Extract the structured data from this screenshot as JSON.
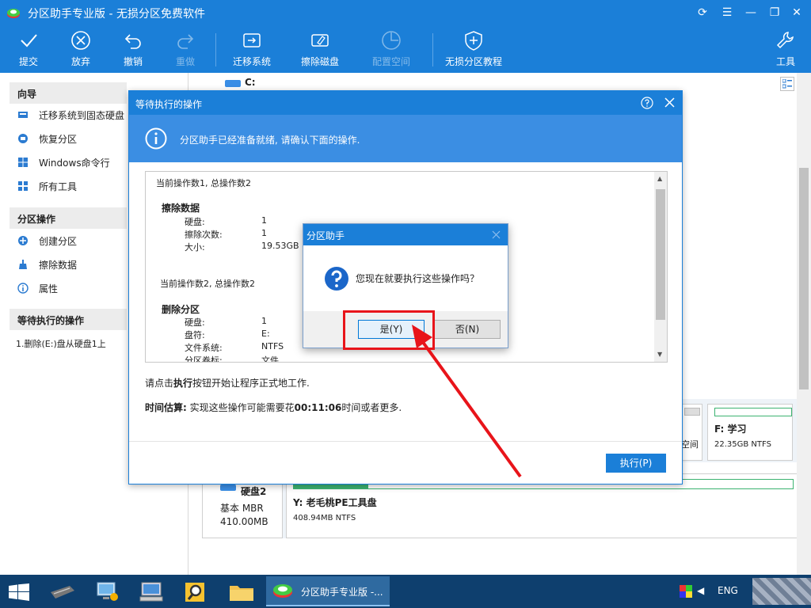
{
  "app": {
    "title": "分区助手专业版 - 无损分区免费软件"
  },
  "toolbar": {
    "items": [
      {
        "label": "提交"
      },
      {
        "label": "放弃"
      },
      {
        "label": "撤销"
      },
      {
        "label": "重做"
      },
      {
        "label": "迁移系统"
      },
      {
        "label": "擦除磁盘"
      },
      {
        "label": "配置空间"
      },
      {
        "label": "无损分区教程"
      },
      {
        "label": "工具"
      }
    ]
  },
  "sidebar": {
    "wizard_title": "向导",
    "wizard_items": [
      {
        "label": "迁移系统到固态硬盘",
        "icon": "migrate-icon"
      },
      {
        "label": "恢复分区",
        "icon": "recover-icon"
      },
      {
        "label": "Windows命令行",
        "icon": "windows-icon"
      },
      {
        "label": "所有工具",
        "icon": "tools-grid-icon"
      }
    ],
    "ops_title": "分区操作",
    "ops_items": [
      {
        "label": "创建分区",
        "icon": "create-partition-icon"
      },
      {
        "label": "擦除数据",
        "icon": "wipe-data-icon"
      },
      {
        "label": "属性",
        "icon": "info-icon"
      }
    ],
    "pending_title": "等待执行的操作",
    "pending_items": [
      "1.删除(E:)盘从硬盘1上"
    ]
  },
  "main": {
    "c_label": "C:",
    "disk2_name": "硬盘2",
    "disk2_type": "基本 MBR",
    "disk2_size": "410.00MB",
    "y_label": "Y: 老毛桃PE工具盘",
    "y_info": "408.94MB NTFS",
    "f_label": "F: 学习",
    "f_info": "22.35GB NTFS",
    "partial_label": "空间"
  },
  "dialog": {
    "title": "等待执行的操作",
    "info": "分区助手已经准备就绪, 请确认下面的操作.",
    "op1_header": "当前操作数1, 总操作数2",
    "op1_title": "擦除数据",
    "op1_rows": [
      {
        "k": "硬盘:",
        "v": "1"
      },
      {
        "k": "擦除次数:",
        "v": "1"
      },
      {
        "k": "大小:",
        "v": "19.53GB"
      }
    ],
    "op2_header": "当前操作数2, 总操作数2",
    "op2_title": "删除分区",
    "op2_rows": [
      {
        "k": "硬盘:",
        "v": "1"
      },
      {
        "k": "盘符:",
        "v": "E:"
      },
      {
        "k": "文件系统:",
        "v": "NTFS"
      },
      {
        "k": "分区卷标:",
        "v": "文件"
      }
    ],
    "hint_pre": "请点击",
    "hint_bold": "执行",
    "hint_post": "按钮开始让程序正式地工作.",
    "est_label": "时间估算:",
    "est_pre": " 实现这些操作可能需要花",
    "est_time": "00:11:06",
    "est_post": "时间或者更多.",
    "execute": "执行(P)"
  },
  "confirm": {
    "title": "分区助手",
    "question": "您现在就要执行这些操作吗？",
    "yes": "是(Y)",
    "no": "否(N)"
  },
  "taskbar": {
    "app_label": "分区助手专业版 -...",
    "lang": "ENG"
  },
  "colors": {
    "accent": "#1b7fd8",
    "highlight": "#e8141a",
    "green": "#3cb371"
  }
}
